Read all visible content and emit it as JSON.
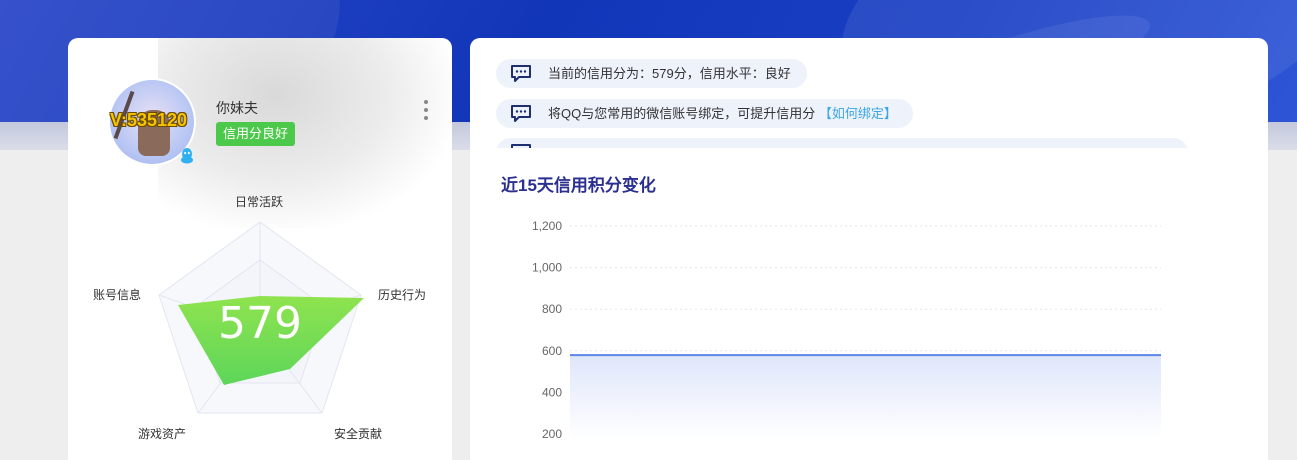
{
  "profile": {
    "vip_label": "V:535120",
    "username": "你妹夫",
    "credit_badge": "信用分良好"
  },
  "radar": {
    "score": "579",
    "dimensions": [
      "日常活跃",
      "历史行为",
      "安全贡献",
      "游戏资产",
      "账号信息"
    ],
    "fill_color": "#6fdc4a"
  },
  "notices": [
    {
      "text": "当前的信用分为：579分，信用水平：良好",
      "link": ""
    },
    {
      "text": "将QQ与您常用的微信账号绑定，可提升信用分",
      "link": "【如何绑定】"
    }
  ],
  "chart_section": {
    "title": "近15天信用积分变化"
  },
  "chart_data": {
    "type": "area",
    "title": "近15天信用积分变化",
    "y_ticks": [
      "1,200",
      "1,000",
      "800",
      "600",
      "400",
      "200"
    ],
    "ylim": [
      200,
      1200
    ],
    "series": [
      {
        "values": [
          579,
          579,
          579,
          579,
          579,
          579,
          579,
          579,
          579,
          579,
          579,
          579,
          579,
          579,
          579
        ]
      }
    ],
    "line_color": "#5b86e5",
    "grid": true
  }
}
